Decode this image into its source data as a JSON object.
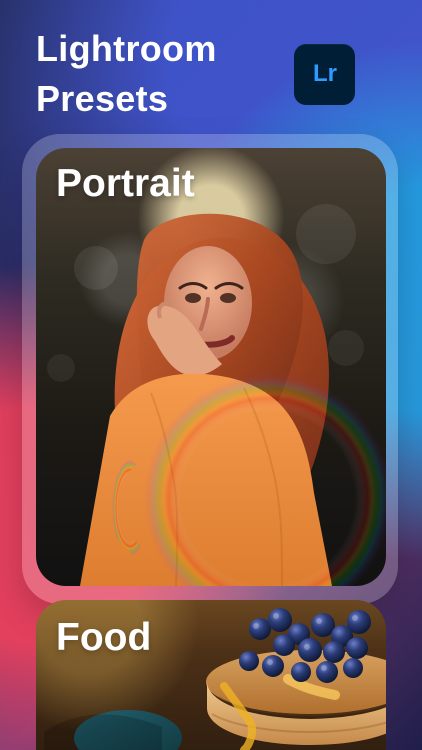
{
  "header": {
    "title_line_1": "Lightroom",
    "title_line_2": "Presets",
    "logo_text": "Lr"
  },
  "cards": [
    {
      "label": "Portrait"
    },
    {
      "label": "Food"
    }
  ],
  "colors": {
    "logo_bg": "#001e36",
    "logo_text": "#2f9bff",
    "text": "#ffffff"
  },
  "icons": {
    "logo": "lightroom-logo"
  }
}
